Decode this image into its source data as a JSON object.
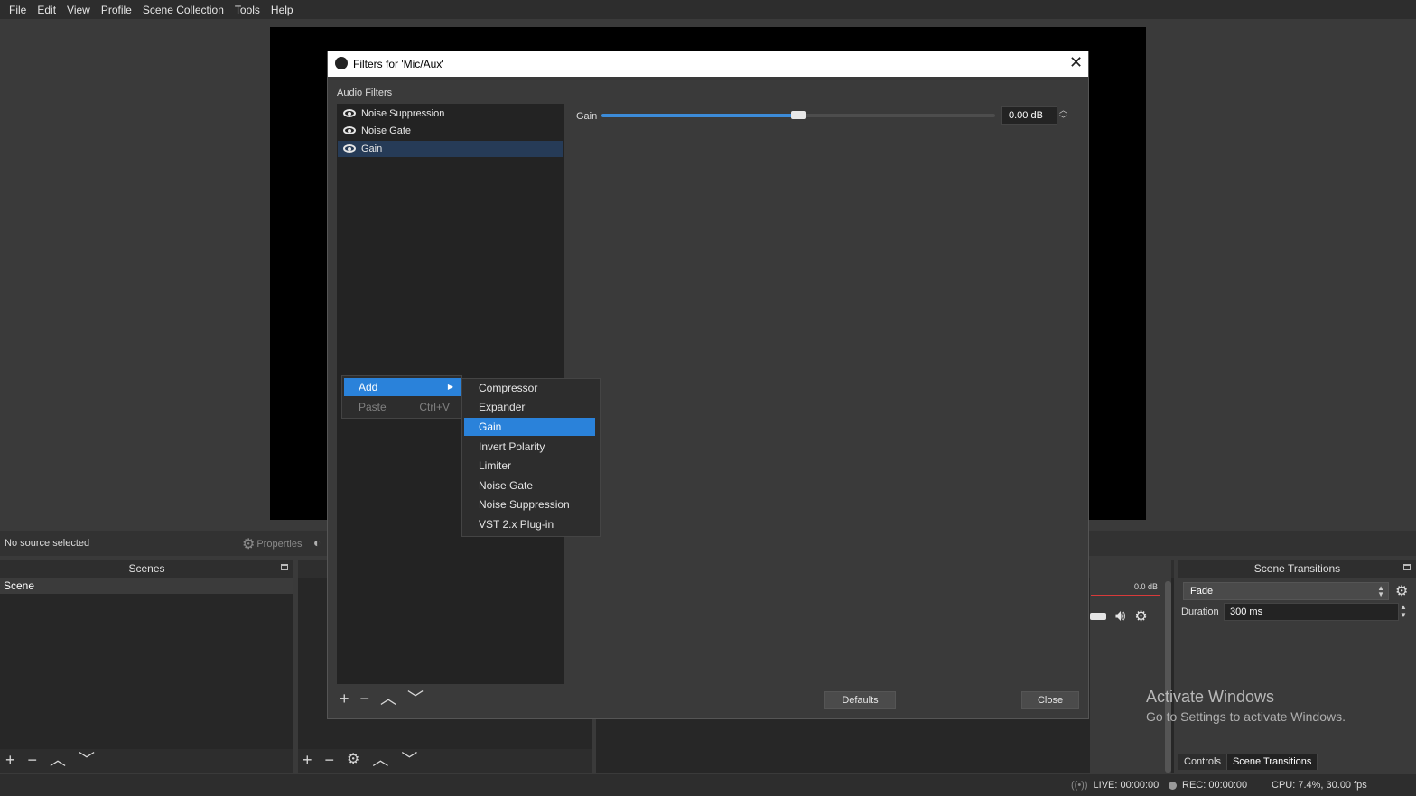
{
  "menubar": {
    "items": [
      "File",
      "Edit",
      "View",
      "Profile",
      "Scene Collection",
      "Tools",
      "Help"
    ]
  },
  "source_toolbar": {
    "no_source": "No source selected",
    "properties": "Properties"
  },
  "scenes": {
    "title": "Scenes",
    "items": [
      "Scene"
    ]
  },
  "mixer": {
    "db_label": "0.0 dB"
  },
  "transitions": {
    "title": "Scene Transitions",
    "selected": "Fade",
    "duration_label": "Duration",
    "duration_value": "300 ms"
  },
  "bottom_tabs": [
    "Controls",
    "Scene Transitions"
  ],
  "watermark": {
    "line1": "Activate Windows",
    "line2": "Go to Settings to activate Windows."
  },
  "status": {
    "live": "LIVE: 00:00:00",
    "rec": "REC: 00:00:00",
    "cpu": "CPU: 7.4%, 30.00 fps"
  },
  "dialog": {
    "title": "Filters for 'Mic/Aux'",
    "section_label": "Audio Filters",
    "filters": [
      {
        "label": "Noise Suppression",
        "selected": false
      },
      {
        "label": "Noise Gate",
        "selected": false
      },
      {
        "label": "Gain",
        "selected": true
      }
    ],
    "gain": {
      "label": "Gain",
      "value": "0.00 dB",
      "slider_fraction": 0.5
    },
    "defaults_label": "Defaults",
    "close_label": "Close"
  },
  "context_menu": {
    "add": "Add",
    "paste": "Paste",
    "paste_shortcut": "Ctrl+V"
  },
  "submenu": {
    "items": [
      "Compressor",
      "Expander",
      "Gain",
      "Invert Polarity",
      "Limiter",
      "Noise Gate",
      "Noise Suppression",
      "VST 2.x Plug-in"
    ],
    "selected": "Gain"
  },
  "colors": {
    "accent": "#2a82da",
    "selection": "#263b57"
  },
  "icons": [
    "eye-icon",
    "gear-icon",
    "plus-icon",
    "minus-icon",
    "up-icon",
    "down-icon",
    "close-icon",
    "speaker-icon",
    "live-icon",
    "rec-dot-icon"
  ]
}
